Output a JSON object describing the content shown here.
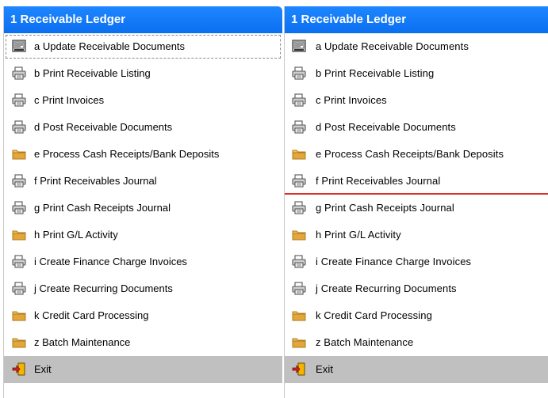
{
  "menu": {
    "title": "1  Receivable Ledger",
    "items": [
      {
        "key": "a",
        "label": "a  Update Receivable Documents",
        "icon": "document-view-icon"
      },
      {
        "key": "b",
        "label": "b  Print Receivable Listing",
        "icon": "printer-icon"
      },
      {
        "key": "c",
        "label": "c  Print Invoices",
        "icon": "printer-icon"
      },
      {
        "key": "d",
        "label": "d  Post Receivable Documents",
        "icon": "printer-icon"
      },
      {
        "key": "e",
        "label": "e  Process Cash Receipts/Bank Deposits",
        "icon": "folder-icon"
      },
      {
        "key": "f",
        "label": "f  Print Receivables Journal",
        "icon": "printer-icon"
      },
      {
        "key": "g",
        "label": "g  Print Cash Receipts Journal",
        "icon": "printer-icon"
      },
      {
        "key": "h",
        "label": "h  Print G/L Activity",
        "icon": "folder-icon"
      },
      {
        "key": "i",
        "label": "i  Create Finance Charge Invoices",
        "icon": "printer-icon"
      },
      {
        "key": "j",
        "label": "j  Create Recurring Documents",
        "icon": "printer-icon"
      },
      {
        "key": "k",
        "label": "k  Credit Card Processing",
        "icon": "folder-icon"
      },
      {
        "key": "z",
        "label": "z  Batch Maintenance",
        "icon": "folder-icon"
      }
    ],
    "exit_label": "Exit",
    "exit_icon": "exit-door-icon"
  },
  "colors": {
    "title_bar": "#0b6ff0",
    "title_text": "#ffffff",
    "exit_bar": "#c0c0c0",
    "drop_indicator": "#e0302a",
    "folder": "#e2a63a",
    "printer": "#6e6e6e"
  }
}
